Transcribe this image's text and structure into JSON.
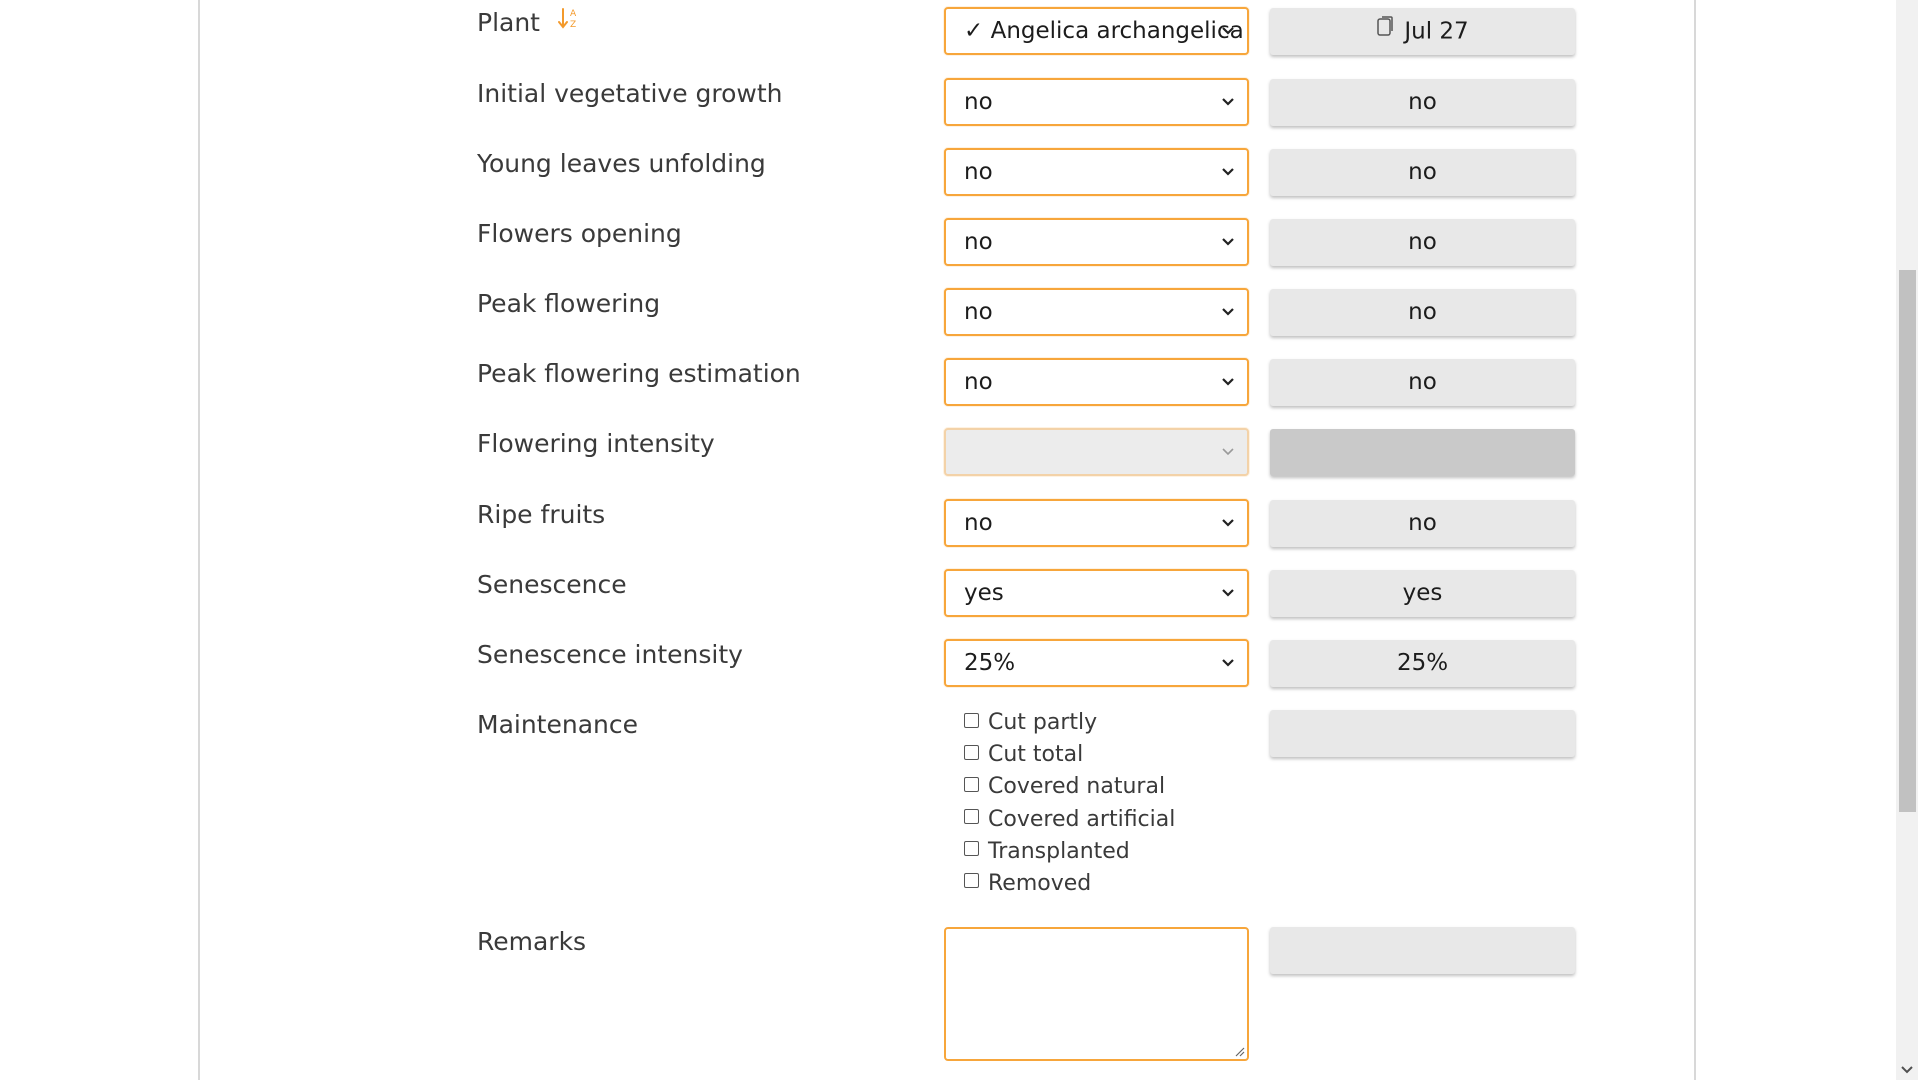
{
  "form": {
    "plant": {
      "label": "Plant",
      "selected": "✓ Angelica archangelica",
      "copy_value": "Jul 27"
    },
    "fields": [
      {
        "label": "Initial vegetative growth",
        "selected": "no",
        "value": "no"
      },
      {
        "label": "Young leaves unfolding",
        "selected": "no",
        "value": "no"
      },
      {
        "label": "Flowers opening",
        "selected": "no",
        "value": "no"
      },
      {
        "label": "Peak flowering",
        "selected": "no",
        "value": "no"
      },
      {
        "label": "Peak flowering estimation",
        "selected": "no",
        "value": "no"
      },
      {
        "label": "Flowering intensity",
        "selected": "",
        "value": ""
      },
      {
        "label": "Ripe fruits",
        "selected": "no",
        "value": "no"
      },
      {
        "label": "Senescence",
        "selected": "yes",
        "value": "yes"
      },
      {
        "label": "Senescence intensity",
        "selected": "25%",
        "value": "25%"
      }
    ],
    "maintenance": {
      "label": "Maintenance",
      "options": [
        "Cut partly",
        "Cut total",
        "Covered natural",
        "Covered artificial",
        "Transplanted",
        "Removed"
      ],
      "value": ""
    },
    "remarks": {
      "label": "Remarks",
      "value": ""
    }
  },
  "colors": {
    "accent": "#f7a63b",
    "value_box": "#e8e8e8",
    "value_box_disabled": "#c9c9c9"
  },
  "icons": {
    "sort": "sort-alpha-down-icon",
    "copy": "clipboard-icon",
    "dropdown": "chevron-down-icon"
  }
}
